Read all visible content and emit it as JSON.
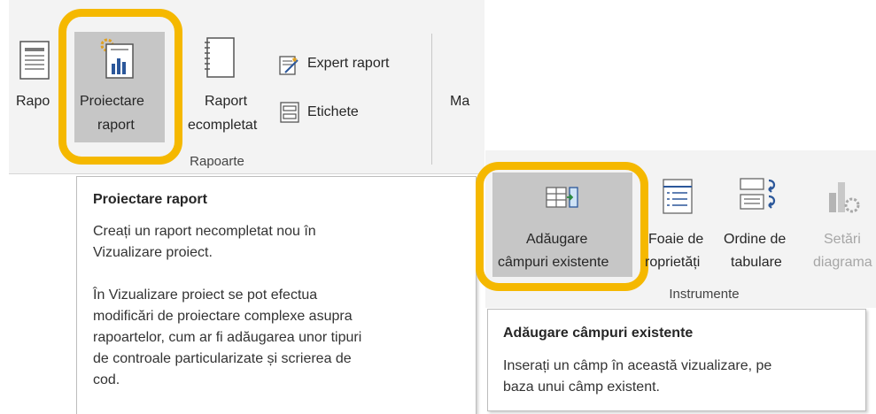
{
  "ribbon_rapoarte": {
    "raport_label_partial": "Rapo",
    "proiectare_label": [
      "Proiectare",
      "raport"
    ],
    "raport_necompletat_label": [
      "Raport",
      "ecompletat"
    ],
    "expert_raport_label": "Expert raport",
    "etichete_label": "Etichete",
    "group_label": "Rapoarte",
    "next_partial_label": "Ma"
  },
  "tooltip_proiectare": {
    "title": "Proiectare raport",
    "line1": "Creați un raport necompletat nou în",
    "line2": "Vizualizare proiect.",
    "line3": "În Vizualizare proiect se pot efectua",
    "line4": "modificări de proiectare complexe asupra",
    "line5": "rapoartelor, cum ar fi adăugarea unor tipuri",
    "line6": "de controale particularizate și scrierea de",
    "line7": "cod."
  },
  "ribbon_instrumente": {
    "adaugare_label": [
      "Adăugare",
      "câmpuri existente"
    ],
    "foaie_label": [
      "Foaie de",
      "roprietăți"
    ],
    "ordine_label": [
      "Ordine de",
      "tabulare"
    ],
    "setari_label": [
      "Setări",
      "diagrama"
    ],
    "group_label": "Instrumente"
  },
  "tooltip_adaugare": {
    "title": "Adăugare câmpuri existente",
    "line1": "Inserați un câmp în această vizualizare, pe",
    "line2": "baza unui câmp existent."
  },
  "colors": {
    "highlight": "#f5b800",
    "ribbon_bg": "#f3f3f3",
    "active_button": "#c6c6c6",
    "icon_blue": "#2b579a"
  }
}
